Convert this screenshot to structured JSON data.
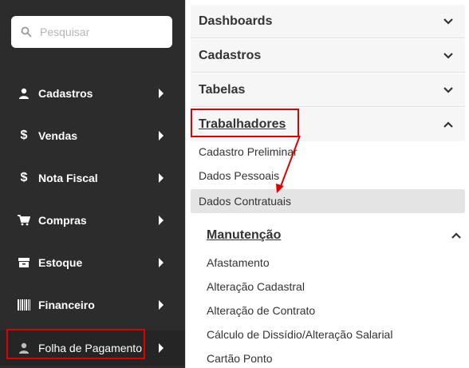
{
  "search": {
    "placeholder": "Pesquisar"
  },
  "sidebar": {
    "items": [
      {
        "label": "Cadastros",
        "icon": "user-icon"
      },
      {
        "label": "Vendas",
        "icon": "dollar-icon"
      },
      {
        "label": "Nota Fiscal",
        "icon": "dollar-icon"
      },
      {
        "label": "Compras",
        "icon": "cart-icon"
      },
      {
        "label": "Estoque",
        "icon": "archive-box-icon"
      },
      {
        "label": "Financeiro",
        "icon": "barcode-icon"
      },
      {
        "label": "Folha de Pagamento",
        "icon": "user-icon",
        "active": true
      }
    ]
  },
  "panel": {
    "sections": [
      {
        "label": "Dashboards",
        "state": "collapsed"
      },
      {
        "label": "Cadastros",
        "state": "collapsed"
      },
      {
        "label": "Tabelas",
        "state": "collapsed"
      },
      {
        "label": "Trabalhadores",
        "state": "expanded"
      }
    ],
    "trabalhadores_items": [
      {
        "label": "Cadastro Preliminar"
      },
      {
        "label": "Dados Pessoais"
      },
      {
        "label": "Dados Contratuais",
        "highlighted": true
      }
    ],
    "manutencao": {
      "label": "Manutenção",
      "items": [
        {
          "label": "Afastamento"
        },
        {
          "label": "Alteração Cadastral"
        },
        {
          "label": "Alteração de Contrato"
        },
        {
          "label": "Cálculo de Dissídio/Alteração Salarial"
        },
        {
          "label": "Cartão Ponto"
        }
      ]
    }
  },
  "colors": {
    "sidebar_bg": "#2c2c2c",
    "annotation_red": "#e00000",
    "highlight_bg": "#e4e4e4"
  }
}
